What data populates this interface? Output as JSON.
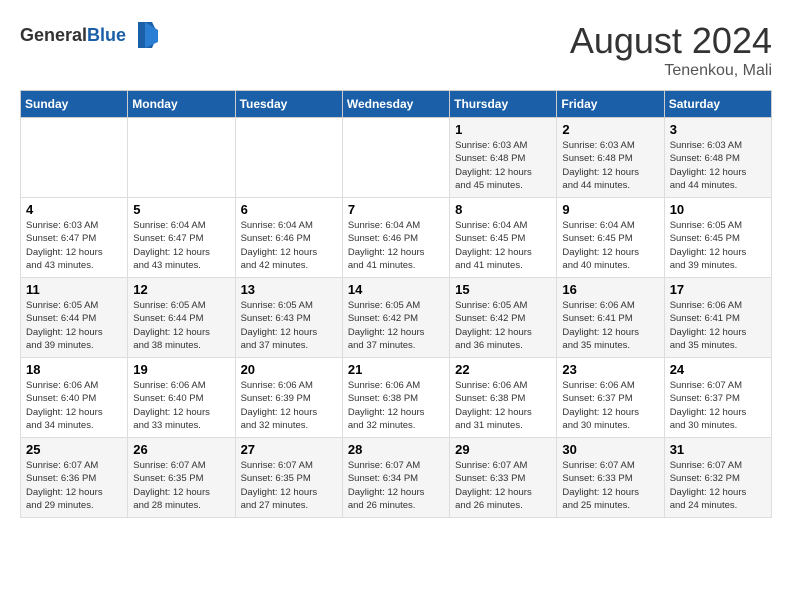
{
  "header": {
    "logo_general": "General",
    "logo_blue": "Blue",
    "month_year": "August 2024",
    "location": "Tenenkou, Mali"
  },
  "days_of_week": [
    "Sunday",
    "Monday",
    "Tuesday",
    "Wednesday",
    "Thursday",
    "Friday",
    "Saturday"
  ],
  "weeks": [
    [
      {
        "day": "",
        "info": ""
      },
      {
        "day": "",
        "info": ""
      },
      {
        "day": "",
        "info": ""
      },
      {
        "day": "",
        "info": ""
      },
      {
        "day": "1",
        "info": "Sunrise: 6:03 AM\nSunset: 6:48 PM\nDaylight: 12 hours\nand 45 minutes."
      },
      {
        "day": "2",
        "info": "Sunrise: 6:03 AM\nSunset: 6:48 PM\nDaylight: 12 hours\nand 44 minutes."
      },
      {
        "day": "3",
        "info": "Sunrise: 6:03 AM\nSunset: 6:48 PM\nDaylight: 12 hours\nand 44 minutes."
      }
    ],
    [
      {
        "day": "4",
        "info": "Sunrise: 6:03 AM\nSunset: 6:47 PM\nDaylight: 12 hours\nand 43 minutes."
      },
      {
        "day": "5",
        "info": "Sunrise: 6:04 AM\nSunset: 6:47 PM\nDaylight: 12 hours\nand 43 minutes."
      },
      {
        "day": "6",
        "info": "Sunrise: 6:04 AM\nSunset: 6:46 PM\nDaylight: 12 hours\nand 42 minutes."
      },
      {
        "day": "7",
        "info": "Sunrise: 6:04 AM\nSunset: 6:46 PM\nDaylight: 12 hours\nand 41 minutes."
      },
      {
        "day": "8",
        "info": "Sunrise: 6:04 AM\nSunset: 6:45 PM\nDaylight: 12 hours\nand 41 minutes."
      },
      {
        "day": "9",
        "info": "Sunrise: 6:04 AM\nSunset: 6:45 PM\nDaylight: 12 hours\nand 40 minutes."
      },
      {
        "day": "10",
        "info": "Sunrise: 6:05 AM\nSunset: 6:45 PM\nDaylight: 12 hours\nand 39 minutes."
      }
    ],
    [
      {
        "day": "11",
        "info": "Sunrise: 6:05 AM\nSunset: 6:44 PM\nDaylight: 12 hours\nand 39 minutes."
      },
      {
        "day": "12",
        "info": "Sunrise: 6:05 AM\nSunset: 6:44 PM\nDaylight: 12 hours\nand 38 minutes."
      },
      {
        "day": "13",
        "info": "Sunrise: 6:05 AM\nSunset: 6:43 PM\nDaylight: 12 hours\nand 37 minutes."
      },
      {
        "day": "14",
        "info": "Sunrise: 6:05 AM\nSunset: 6:42 PM\nDaylight: 12 hours\nand 37 minutes."
      },
      {
        "day": "15",
        "info": "Sunrise: 6:05 AM\nSunset: 6:42 PM\nDaylight: 12 hours\nand 36 minutes."
      },
      {
        "day": "16",
        "info": "Sunrise: 6:06 AM\nSunset: 6:41 PM\nDaylight: 12 hours\nand 35 minutes."
      },
      {
        "day": "17",
        "info": "Sunrise: 6:06 AM\nSunset: 6:41 PM\nDaylight: 12 hours\nand 35 minutes."
      }
    ],
    [
      {
        "day": "18",
        "info": "Sunrise: 6:06 AM\nSunset: 6:40 PM\nDaylight: 12 hours\nand 34 minutes."
      },
      {
        "day": "19",
        "info": "Sunrise: 6:06 AM\nSunset: 6:40 PM\nDaylight: 12 hours\nand 33 minutes."
      },
      {
        "day": "20",
        "info": "Sunrise: 6:06 AM\nSunset: 6:39 PM\nDaylight: 12 hours\nand 32 minutes."
      },
      {
        "day": "21",
        "info": "Sunrise: 6:06 AM\nSunset: 6:38 PM\nDaylight: 12 hours\nand 32 minutes."
      },
      {
        "day": "22",
        "info": "Sunrise: 6:06 AM\nSunset: 6:38 PM\nDaylight: 12 hours\nand 31 minutes."
      },
      {
        "day": "23",
        "info": "Sunrise: 6:06 AM\nSunset: 6:37 PM\nDaylight: 12 hours\nand 30 minutes."
      },
      {
        "day": "24",
        "info": "Sunrise: 6:07 AM\nSunset: 6:37 PM\nDaylight: 12 hours\nand 30 minutes."
      }
    ],
    [
      {
        "day": "25",
        "info": "Sunrise: 6:07 AM\nSunset: 6:36 PM\nDaylight: 12 hours\nand 29 minutes."
      },
      {
        "day": "26",
        "info": "Sunrise: 6:07 AM\nSunset: 6:35 PM\nDaylight: 12 hours\nand 28 minutes."
      },
      {
        "day": "27",
        "info": "Sunrise: 6:07 AM\nSunset: 6:35 PM\nDaylight: 12 hours\nand 27 minutes."
      },
      {
        "day": "28",
        "info": "Sunrise: 6:07 AM\nSunset: 6:34 PM\nDaylight: 12 hours\nand 26 minutes."
      },
      {
        "day": "29",
        "info": "Sunrise: 6:07 AM\nSunset: 6:33 PM\nDaylight: 12 hours\nand 26 minutes."
      },
      {
        "day": "30",
        "info": "Sunrise: 6:07 AM\nSunset: 6:33 PM\nDaylight: 12 hours\nand 25 minutes."
      },
      {
        "day": "31",
        "info": "Sunrise: 6:07 AM\nSunset: 6:32 PM\nDaylight: 12 hours\nand 24 minutes."
      }
    ]
  ]
}
